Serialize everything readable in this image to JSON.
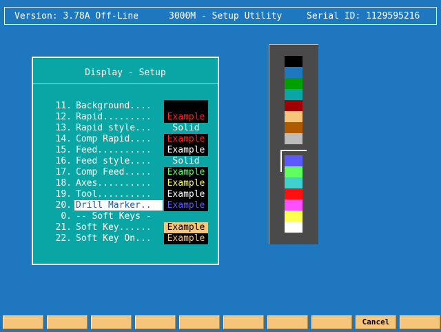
{
  "header": {
    "version": "Version: 3.78A Off-Line",
    "title": "3000M - Setup Utility",
    "serial": "Serial ID: 1129595216"
  },
  "panel": {
    "title": "Display - Setup",
    "rows": [
      {
        "num": "11.",
        "label": "Background....",
        "value": ""
      },
      {
        "num": "12.",
        "label": "Rapid.........",
        "value": "Example"
      },
      {
        "num": "13.",
        "label": "Rapid style...",
        "value": "Solid"
      },
      {
        "num": "14.",
        "label": "Comp Rapid....",
        "value": "Example"
      },
      {
        "num": "15.",
        "label": "Feed..........",
        "value": "Example"
      },
      {
        "num": "16.",
        "label": "Feed style....",
        "value": "Solid"
      },
      {
        "num": "17.",
        "label": "Comp Feed.....",
        "value": "Example"
      },
      {
        "num": "18.",
        "label": "Axes..........",
        "value": "Example"
      },
      {
        "num": "19.",
        "label": "Tool..........",
        "value": "Example"
      },
      {
        "num": "20.",
        "label": "Drill Marker..",
        "value": "Example"
      },
      {
        "num": "0.",
        "label": "-- Soft Keys -",
        "value": ""
      },
      {
        "num": "21.",
        "label": "Soft Key......",
        "value": "Example"
      },
      {
        "num": "22.",
        "label": "Soft Key On...",
        "value": "Example"
      }
    ],
    "colors": {
      "rapid": "#ff2020",
      "comp_rapid": "#ff2020",
      "feed": "#ffffff",
      "comp_feed": "#60ff60",
      "axes": "#ffff60",
      "tool": "#ffffff",
      "drill_marker": "#5a5aff",
      "soft_key": "#000000",
      "soft_key_on": "#f7c57a"
    }
  },
  "palette": {
    "colors": [
      "#000000",
      "#1f78bf",
      "#00a000",
      "#0aa6a6",
      "#a00000",
      "#f7c57a",
      "#b05a00",
      "#bcbcbc",
      "#5a5aff",
      "#60ff60",
      "#40d0d0",
      "#ff1010",
      "#ff50ff",
      "#ffff50",
      "#ffffff"
    ]
  },
  "softkeys": {
    "labels": [
      "",
      "",
      "",
      "",
      "",
      "",
      "",
      "",
      "Cancel",
      ""
    ]
  }
}
